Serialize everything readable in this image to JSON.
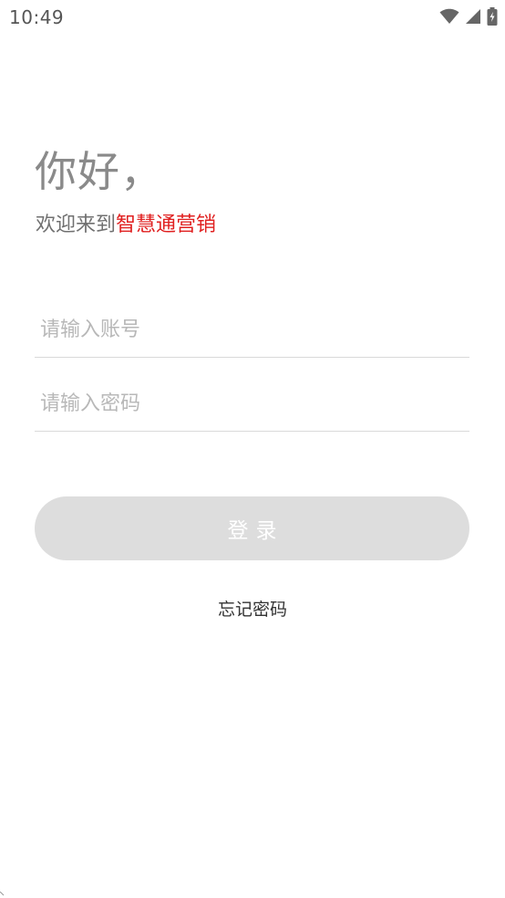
{
  "status_bar": {
    "time": "10:49",
    "icons": [
      "wifi-icon",
      "cellular-signal-icon",
      "battery-charging-icon"
    ]
  },
  "header": {
    "greeting": "你好，",
    "welcome_prefix": "欢迎来到",
    "brand_name": "智慧通营销"
  },
  "form": {
    "account": {
      "placeholder": "请输入账号",
      "value": ""
    },
    "password": {
      "placeholder": "请输入密码",
      "value": ""
    },
    "login_label": "登录",
    "forgot_password_label": "忘记密码"
  },
  "colors": {
    "brand": "#e02020",
    "button_disabled": "#dddddd",
    "greeting": "#8a8a8a"
  }
}
